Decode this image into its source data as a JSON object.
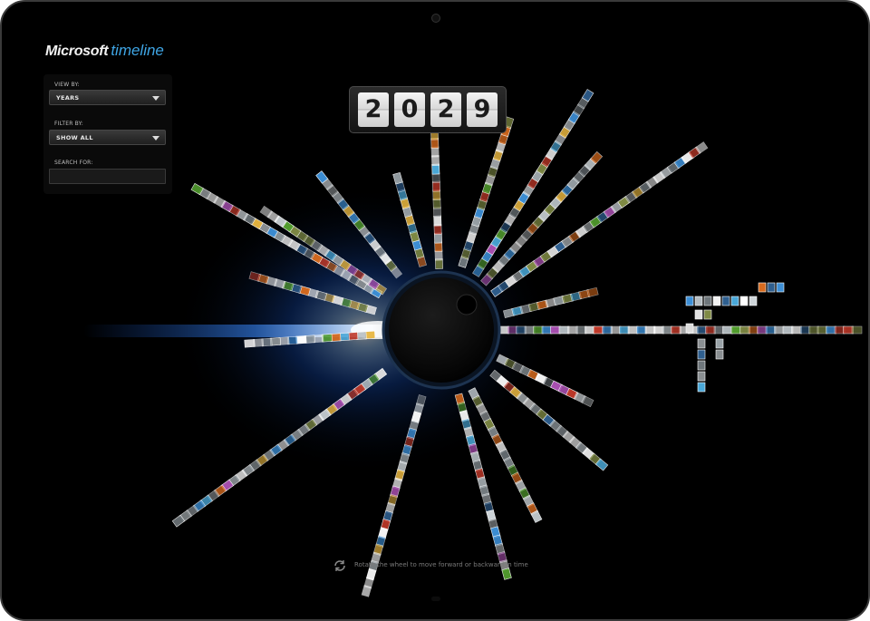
{
  "brand": {
    "name": "Microsoft",
    "product": "timeline"
  },
  "controls": {
    "view_by": {
      "label": "VIEW BY:",
      "value": "YEARS"
    },
    "filter_by": {
      "label": "FILTER BY:",
      "value": "SHOW ALL"
    },
    "search": {
      "label": "SEARCH FOR:",
      "value": "",
      "placeholder": ""
    }
  },
  "year_counter": {
    "digits": [
      "2",
      "0",
      "2",
      "9"
    ]
  },
  "hint": {
    "icon": "rotate-icon",
    "text": "Rotate the wheel to move forward or backward in time"
  },
  "wheel": {
    "thumbnail_palette": [
      "#cfd6da",
      "#9aa3a8",
      "#e2e2e2",
      "#6e767b",
      "#3d8fd6",
      "#f2f2f2",
      "#b4bcc1",
      "#d86b1e",
      "#7f8a44",
      "#2f5f8f",
      "#c23a2a",
      "#8a8f92",
      "#e8b640",
      "#54a02f",
      "#dcdcdc",
      "#a84fb0",
      "#4aa8d8",
      "#ffffff"
    ],
    "glow_color": "#1e6cff",
    "hub_color": "#000000"
  },
  "colors": {
    "background": "#000000",
    "accent": "#3fa6e6",
    "bezel": "#3a3a3a"
  }
}
